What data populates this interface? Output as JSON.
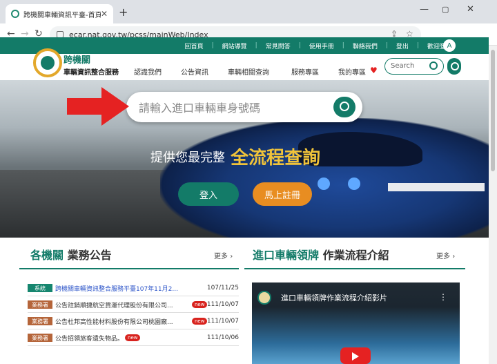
{
  "browser": {
    "tab_title": "跨機關車輛資訊平臺-首頁",
    "url": "ecar.nat.gov.tw/pcss/mainWeb/Index"
  },
  "topbar": {
    "links": [
      "回首頁",
      "網站導覽",
      "常見問答",
      "使用手冊",
      "聯絡我們",
      "登出"
    ],
    "welcome": "歡迎登入:",
    "avatar": "A"
  },
  "brand": {
    "line1": "跨機關",
    "line2": "車輛資訊整合服務"
  },
  "nav": [
    "認識我們",
    "公告資訊",
    "車輛相關查詢",
    "服務專區",
    "我的專區"
  ],
  "search": {
    "placeholder": "Search"
  },
  "hero": {
    "search_placeholder": "請輸入進口車輛車身號碼",
    "slogan_prefix": "提供您最完整",
    "slogan_highlight": "全流程查詢",
    "login_label": "登入",
    "register_label": "馬上註冊"
  },
  "news": {
    "title_highlight": "各機關",
    "title_rest": "業務公告",
    "more": "更多",
    "items": [
      {
        "tag": "系統",
        "tag_type": "sys",
        "text": "跨機關車輛資訊整合服務平臺107年11月2...",
        "is_new": false,
        "date": "107/11/25"
      },
      {
        "tag": "業務署",
        "tag_type": "biz",
        "text": "公告註銷順捷航空貨運代理股份有限公司...",
        "is_new": true,
        "date": "111/10/07"
      },
      {
        "tag": "業務署",
        "tag_type": "biz",
        "text": "公告杜邦高性能材料股份有限公司桃園廠...",
        "is_new": true,
        "date": "111/10/07"
      },
      {
        "tag": "業務署",
        "tag_type": "biz",
        "text": "公告招領旅客遺失物品。",
        "is_new": true,
        "date": "111/10/06"
      }
    ],
    "new_label": "new"
  },
  "process": {
    "title_highlight": "進口車輛領牌",
    "title_rest": "作業流程介紹",
    "more": "更多",
    "video_title": "進口車輛領牌作業流程介紹影片"
  },
  "colors": {
    "primary": "#137b68",
    "accent": "#e88d21",
    "alert": "#d8231e",
    "highlight": "#f0c33a"
  }
}
